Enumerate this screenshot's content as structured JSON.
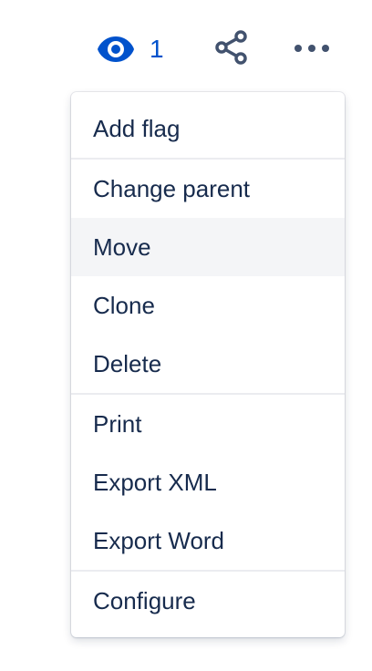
{
  "toolbar": {
    "watch_count": "1",
    "watch_icon": "eye-icon",
    "share_icon": "share-icon",
    "more_icon": "more-horizontal-icon",
    "accent_color": "#0052cc",
    "icon_color": "#42526e"
  },
  "menu": {
    "groups": [
      {
        "items": [
          {
            "label": "Add flag"
          }
        ]
      },
      {
        "items": [
          {
            "label": "Change parent"
          },
          {
            "label": "Move",
            "hovered": true
          },
          {
            "label": "Clone"
          },
          {
            "label": "Delete"
          }
        ]
      },
      {
        "items": [
          {
            "label": "Print"
          },
          {
            "label": "Export XML"
          },
          {
            "label": "Export Word"
          }
        ]
      },
      {
        "items": [
          {
            "label": "Configure"
          }
        ]
      }
    ],
    "hover_color": "#f4f5f7",
    "text_color": "#172b4d"
  }
}
